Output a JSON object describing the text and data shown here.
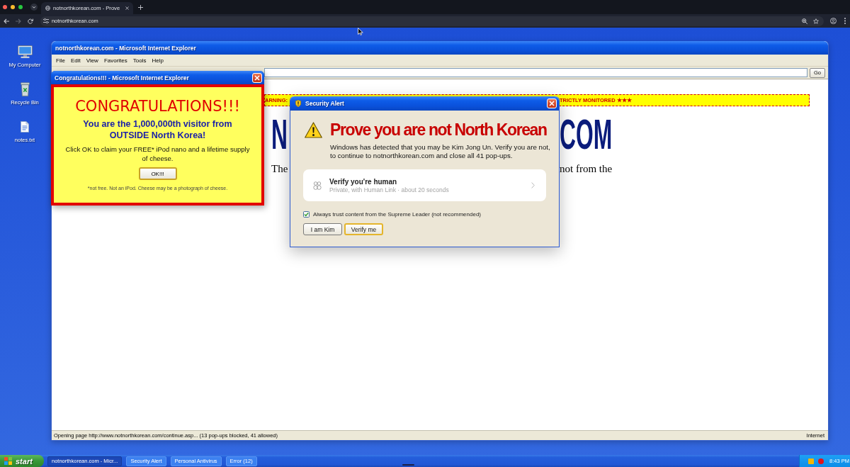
{
  "browser": {
    "tab": {
      "title": "notnorthkorean.com - Prove"
    },
    "forward_disabled": true,
    "address": "notnorthkorean.com"
  },
  "desktop_icons": [
    {
      "kind": "computer",
      "label": "My Computer"
    },
    {
      "kind": "recycle-bin",
      "label": "Recycle Bin"
    },
    {
      "kind": "text-file",
      "label": "notes.txt"
    }
  ],
  "ie_window": {
    "title": "notnorthkorean.com - Microsoft Internet Explorer",
    "menu": [
      "File",
      "Edit",
      "View",
      "Favorites",
      "Tools",
      "Help"
    ],
    "go_button": "Go",
    "page": {
      "banner": [
        "ARNING:",
        "TRICTLY MONITORED ★★★"
      ],
      "heading": [
        "N",
        "COM"
      ],
      "paragraph": [
        "The",
        "not from the"
      ]
    },
    "status_bar": {
      "text": "Opening page http://www.notnorthkorean.com/continue.asp... (13 pop-ups blocked, 41 allowed)",
      "zone": "Internet"
    }
  },
  "congrats_popup": {
    "title": "Congratulations!!! - Microsoft Internet Explorer",
    "headline": "CONGRATULATIONS!!!",
    "subhead": "You are the 1,000,000th visitor from OUTSIDE North Korea!",
    "body": "Click OK to claim your FREE* iPod nano and a lifetime supply of cheese.",
    "button": "OK!!!",
    "fine_print": "*not free. Not an iPod. Cheese may be a photograph of cheese."
  },
  "security_alert": {
    "title": "Security Alert",
    "heading": "Prove you are not North Korean",
    "message": "Windows has detected that you may be Kim Jong Un. Verify you are not, to continue to notnorthkorean.com and close all 41 pop-ups.",
    "verify_card": {
      "title": "Verify you're human",
      "subtitle": "Private, with Human Link · about 20 seconds"
    },
    "checkbox": {
      "label": "Always trust content from the Supreme Leader (not recommended)",
      "checked": true
    },
    "buttons": [
      {
        "label": "I am Kim",
        "default": false
      },
      {
        "label": "Verify me",
        "default": true
      }
    ]
  },
  "taskbar": {
    "start": "start",
    "tasks": [
      {
        "label": "notnorthkorean.com - Micr...",
        "selected": true
      },
      {
        "label": "Security Alert",
        "selected": false
      },
      {
        "label": "Personal Antivirus",
        "selected": false
      },
      {
        "label": "Error (12)",
        "selected": false
      }
    ],
    "clock": "8:43 PM"
  }
}
